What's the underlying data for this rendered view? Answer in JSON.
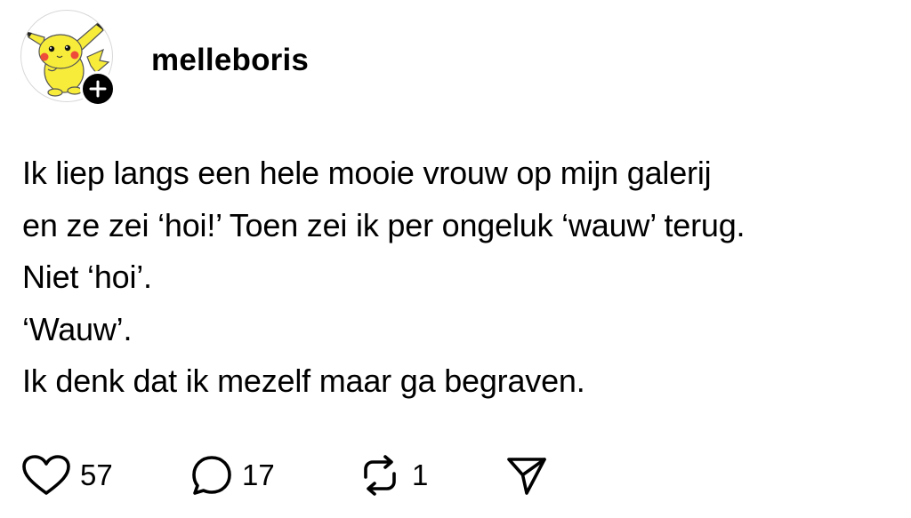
{
  "post": {
    "username": "melleboris",
    "body_lines": [
      "Ik liep langs een hele mooie vrouw op mijn galerij",
      "en ze zei ‘hoi!’ Toen zei ik per ongeluk ‘wauw’ terug.",
      "Niet ‘hoi’.",
      "‘Wauw’.",
      "Ik denk dat ik mezelf maar ga begraven."
    ],
    "avatar_icon": "pikachu-avatar-icon",
    "follow_icon": "plus-icon"
  },
  "actions": {
    "like": {
      "icon": "heart-icon",
      "count": "57"
    },
    "reply": {
      "icon": "comment-bubble-icon",
      "count": "17"
    },
    "repost": {
      "icon": "repost-icon",
      "count": "1"
    },
    "share": {
      "icon": "send-paper-plane-icon"
    }
  },
  "colors": {
    "background": "#ffffff",
    "text": "#000000",
    "avatar_border": "#d8d8d8",
    "pikachu_yellow": "#f7ec3a",
    "pikachu_cheek": "#ef4b3a"
  }
}
